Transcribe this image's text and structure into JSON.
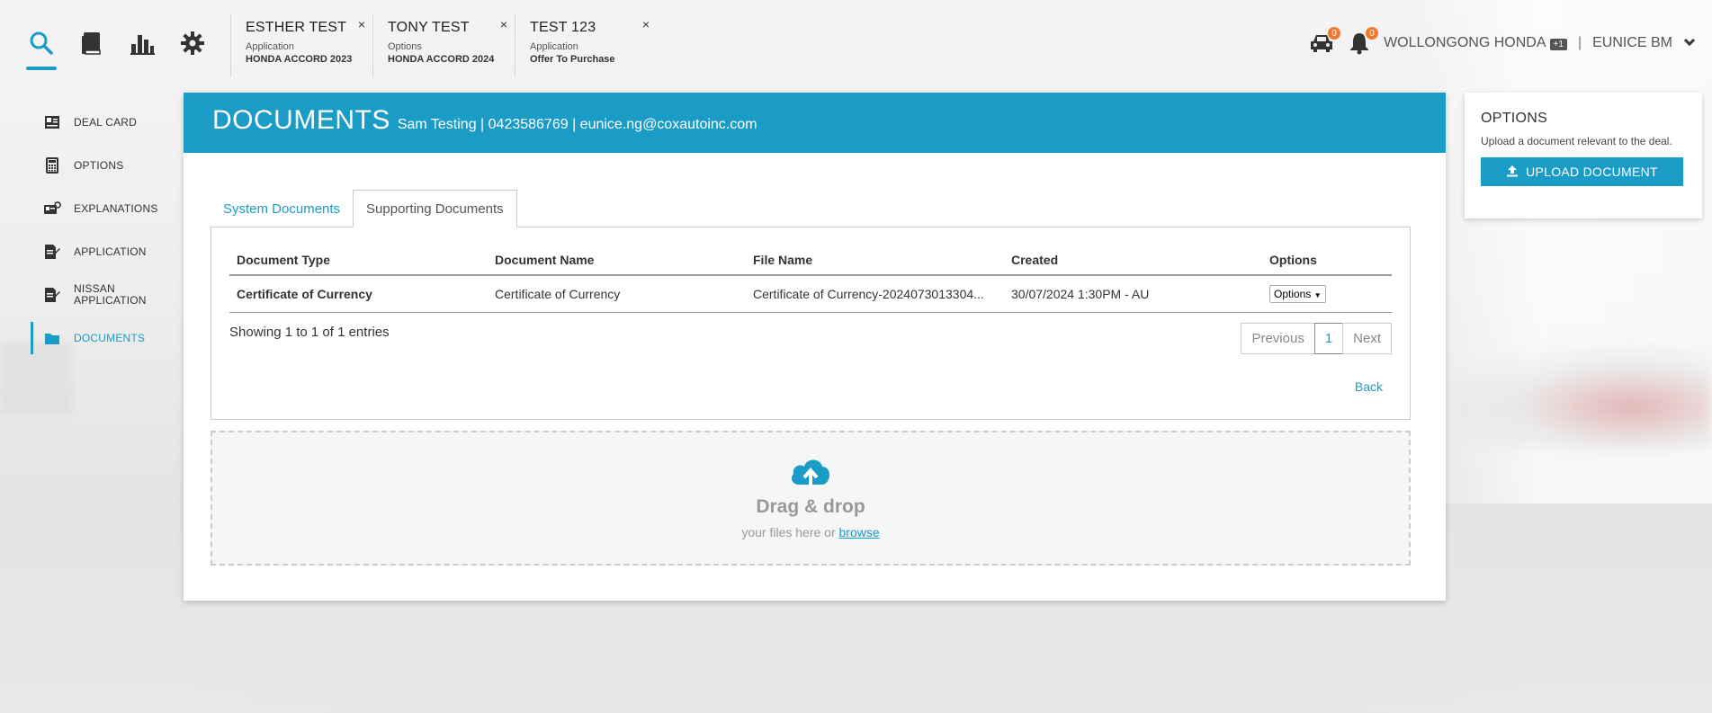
{
  "colors": {
    "accent": "#1b9cc6",
    "badge": "#f07a2b"
  },
  "top_nav": {
    "icons": [
      "search-icon",
      "book-icon",
      "bar-chart-icon",
      "gear-icon"
    ],
    "deal_tabs": [
      {
        "name": "ESTHER TEST",
        "sub": "Application",
        "vehicle": "HONDA ACCORD 2023",
        "close": "×"
      },
      {
        "name": "TONY TEST",
        "sub": "Options",
        "vehicle": "HONDA ACCORD 2024",
        "close": "×"
      },
      {
        "name": "TEST 123",
        "sub": "Application",
        "vehicle": "Offer To Purchase",
        "close": "×"
      }
    ],
    "car_badge": "0",
    "bell_badge": "0",
    "dealer": "WOLLONGONG HONDA",
    "dealer_count": "+1",
    "separator": "|",
    "user": "EUNICE BM"
  },
  "sidebar": {
    "items": [
      {
        "label": "DEAL CARD",
        "icon": "deal-card-icon"
      },
      {
        "label": "OPTIONS",
        "icon": "calculator-icon"
      },
      {
        "label": "EXPLANATIONS",
        "icon": "explanations-icon"
      },
      {
        "label": "APPLICATION",
        "icon": "application-icon"
      },
      {
        "label": "NISSAN APPLICATION",
        "icon": "nissan-application-icon"
      },
      {
        "label": "DOCUMENTS",
        "icon": "folder-icon"
      }
    ]
  },
  "main": {
    "title": "DOCUMENTS",
    "subtitle": "Sam Testing | 0423586769 | eunice.ng@coxautoinc.com",
    "tabs": [
      {
        "label": "System Documents"
      },
      {
        "label": "Supporting Documents"
      }
    ],
    "table": {
      "headers": [
        "Document Type",
        "Document Name",
        "File Name",
        "Created",
        "Options"
      ],
      "rows": [
        [
          "Certificate of Currency",
          "Certificate of Currency",
          "Certificate of Currency-2024073013304...",
          "30/07/2024 1:30PM - AU",
          "Options"
        ]
      ]
    },
    "showing": "Showing 1 to 1 of 1 entries",
    "pager": {
      "prev": "Previous",
      "current": "1",
      "next": "Next"
    },
    "back": "Back",
    "dropzone": {
      "title": "Drag & drop",
      "sub": "your files here or",
      "link": "browse"
    }
  },
  "options_card": {
    "title": "OPTIONS",
    "description": "Upload a document relevant to the deal.",
    "button": "UPLOAD DOCUMENT"
  }
}
